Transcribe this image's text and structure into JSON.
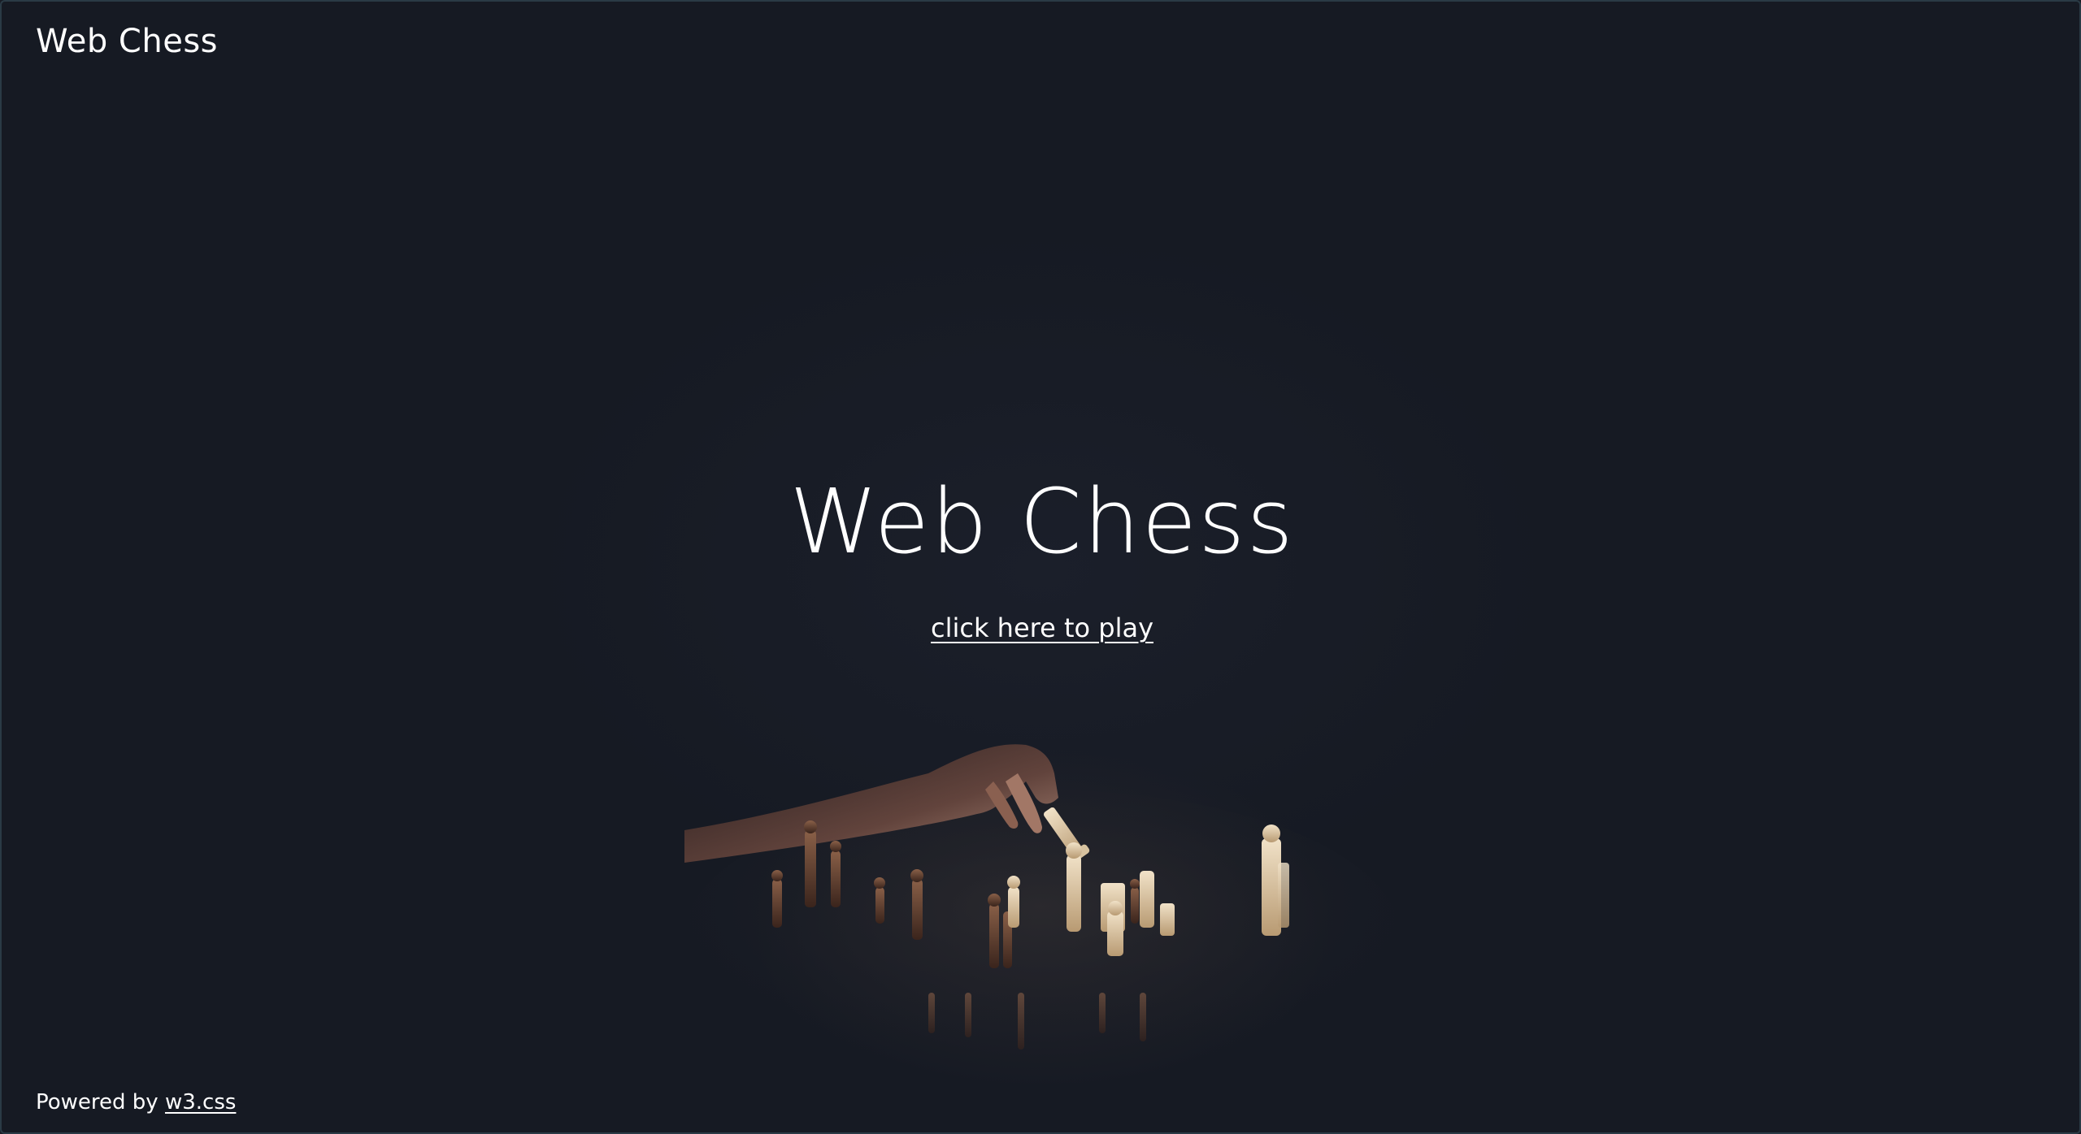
{
  "header": {
    "brand": "Web Chess"
  },
  "hero": {
    "title": "Web Chess",
    "play_link": "click here to play"
  },
  "footer": {
    "powered_by": "Powered by",
    "link_label": "w3.css"
  },
  "theme": {
    "background": "#181c25",
    "text": "#ffffff"
  }
}
